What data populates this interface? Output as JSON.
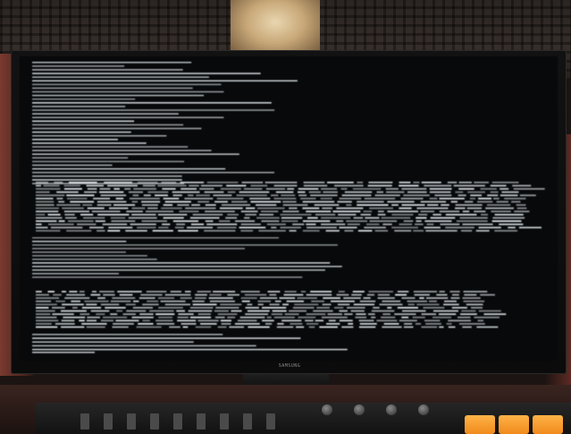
{
  "photo": {
    "monitor_brand": "SAMSUNG",
    "screen_content": "console-text",
    "colors": {
      "wall": "#2f2824",
      "screen_bg": "#07090b",
      "console_text": "#e8eef2",
      "desk": "#3a2420",
      "pads": "#f5a030"
    }
  }
}
